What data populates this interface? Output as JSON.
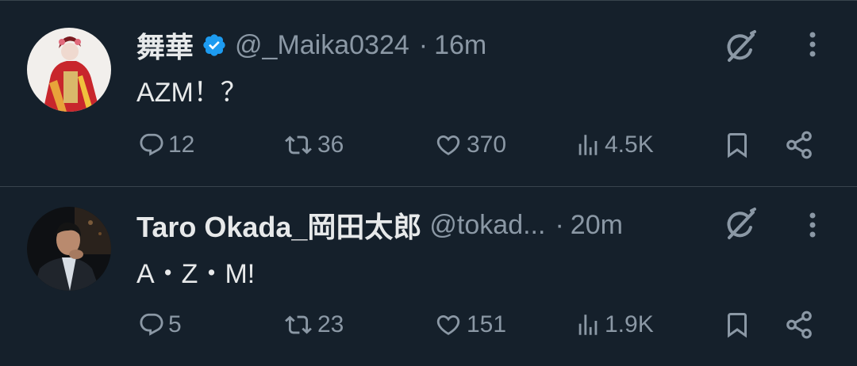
{
  "tweets": [
    {
      "name": "舞華",
      "verified": true,
      "handle": "@_Maika0324",
      "separator": "·",
      "time": "16m",
      "text": "AZM！？",
      "replies": "12",
      "retweets": "36",
      "likes": "370",
      "views": "4.5K",
      "avatar_icon": "avatar-photo"
    },
    {
      "name": "Taro Okada_岡田太郎",
      "verified": false,
      "handle": "@tokad...",
      "separator": "·",
      "time": "20m",
      "text": "A・Z・M!",
      "replies": "5",
      "retweets": "23",
      "likes": "151",
      "views": "1.9K",
      "avatar_icon": "avatar-photo"
    }
  ],
  "icons": {
    "grok": "grok-icon",
    "more": "more-icon",
    "reply": "reply-icon",
    "retweet": "retweet-icon",
    "like": "like-icon",
    "views": "views-icon",
    "bookmark": "bookmark-icon",
    "share": "share-icon",
    "verified": "verified-badge-icon"
  },
  "colors": {
    "background": "#15202b",
    "text": "#e7e9ea",
    "secondary": "#8b98a5",
    "verified": "#1d9bf0",
    "divider": "#38444d"
  }
}
